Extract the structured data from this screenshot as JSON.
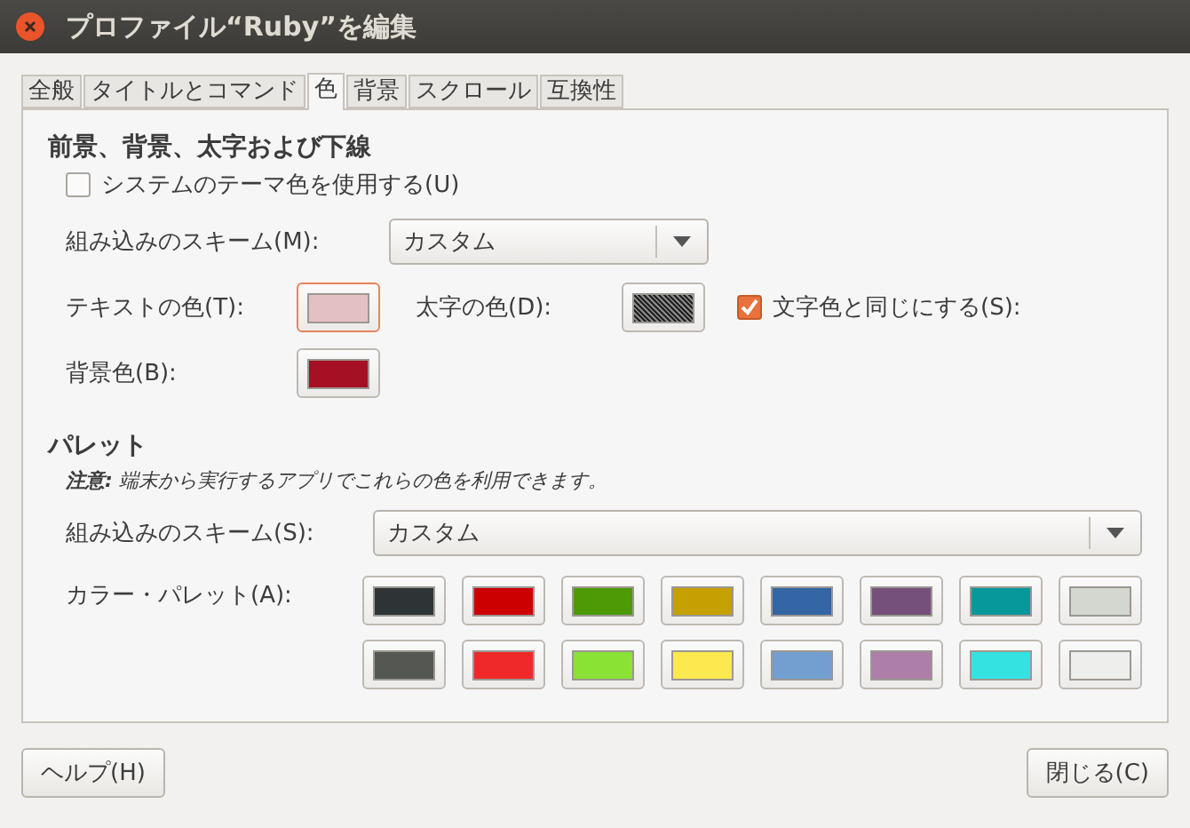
{
  "window": {
    "title": "プロファイル“Ruby”を編集"
  },
  "tabs": [
    {
      "label": "全般",
      "selected": false
    },
    {
      "label": "タイトルとコマンド",
      "selected": false
    },
    {
      "label": "色",
      "selected": true
    },
    {
      "label": "背景",
      "selected": false
    },
    {
      "label": "スクロール",
      "selected": false
    },
    {
      "label": "互換性",
      "selected": false
    }
  ],
  "foreground_section": {
    "heading": "前景、背景、太字および下線",
    "use_system_theme": {
      "label": "システムのテーマ色を使用する(U)",
      "checked": false
    },
    "scheme": {
      "label": "組み込みのスキーム(M):",
      "value": "カスタム"
    },
    "text_color": {
      "label": "テキストの色(T):",
      "color": "#e3c0c2",
      "focused": true
    },
    "bold_color": {
      "label": "太字の色(D):",
      "disabled": true
    },
    "same_as_text": {
      "label": "文字色と同じにする(S):",
      "checked": true
    },
    "background_color": {
      "label": "背景色(B):",
      "color": "#a51024",
      "focused": false
    }
  },
  "palette_section": {
    "heading": "パレット",
    "note": "**注意:** 端末から実行するアプリでこれらの色を利用できます。",
    "scheme": {
      "label": "組み込みのスキーム(S):",
      "value": "カスタム"
    },
    "palette_label": "カラー・パレット(A):",
    "colors": [
      {
        "color": "#2e3436"
      },
      {
        "color": "#cc0000"
      },
      {
        "color": "#4e9a06"
      },
      {
        "color": "#c4a000"
      },
      {
        "color": "#3465a4"
      },
      {
        "color": "#75507b"
      },
      {
        "color": "#06989a"
      },
      {
        "color": "#d3d7cf"
      },
      {
        "color": "#555753"
      },
      {
        "color": "#ef2929"
      },
      {
        "color": "#8ae234"
      },
      {
        "color": "#fce94f"
      },
      {
        "color": "#729fcf"
      },
      {
        "color": "#ad7fa8"
      },
      {
        "color": "#34e2e2"
      },
      {
        "color": "#eeeeec"
      }
    ]
  },
  "buttons": [
    {
      "label": "ヘルプ(H)"
    },
    {
      "label": "閉じる(C)"
    }
  ]
}
